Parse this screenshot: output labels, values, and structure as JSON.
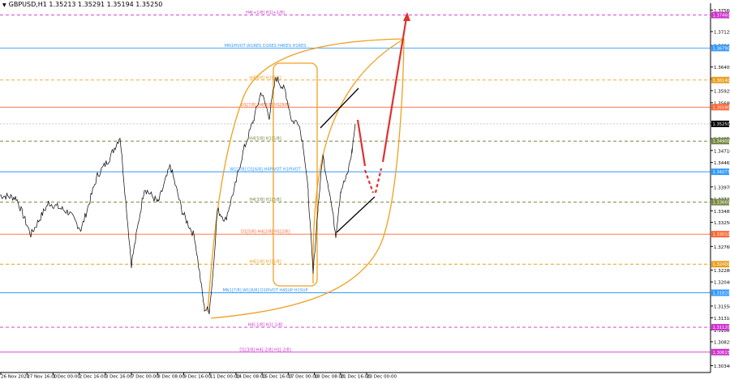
{
  "header": {
    "symbol_line": "GBPUSD,H1  1.35213 1.35291 1.35194 1.35250",
    "triangle_icon": "triangle-down-icon"
  },
  "chart_data": {
    "type": "line",
    "title": "GBPUSD,H1",
    "ohlc": {
      "open": 1.35213,
      "high": 1.35291,
      "low": 1.35194,
      "close": 1.3525
    },
    "y_ticks": [
      1.3756,
      1.37125,
      1.36845,
      1.36405,
      1.36165,
      1.35925,
      1.3568,
      1.3525,
      1.3495,
      1.3471,
      1.34465,
      1.3397,
      1.33725,
      1.33485,
      1.3325,
      1.3276,
      1.3228,
      1.3204,
      1.3155,
      1.3131,
      1.31065,
      1.30825,
      1.3034
    ],
    "x_ticks": [
      "26 Nov 2020",
      "27 Nov 16:00",
      "1 Dec 00:00",
      "2 Dec 16:00",
      "3 Dec 16:00",
      "7 Dec 00:00",
      "8 Dec 08:00",
      "9 Dec 16:00",
      "11 Dec 00:00",
      "14 Dec 08:00",
      "15 Dec 16:00",
      "17 Dec 00:00",
      "18 Dec 08:00",
      "21 Dec 16:00",
      "23 Dec 00:00"
    ],
    "price_line": {
      "value": 1.3525,
      "label": "1.35250",
      "color": "#000000"
    },
    "levels": [
      {
        "label": "H4[+1/8] H1[+1/8]",
        "value": 1.3746,
        "tag": "1.37460",
        "color": "#cc33cc",
        "dash": "dashed"
      },
      {
        "label": "MN1PIVOT W1RES D1RES H4RES H1RES",
        "value": 1.3679,
        "tag": "1.36790",
        "color": "#3399ff",
        "dash": "solid"
      },
      {
        "label": "H4[8/8] H1[8/8]",
        "value": 1.3614,
        "tag": "1.36140",
        "color": "#e8a020",
        "dash": "dashed"
      },
      {
        "label": "D1[7/8] H4[8/8] H1[8/8]",
        "value": 1.3559,
        "tag": "1.35590",
        "color": "#ff6633",
        "dash": "solid"
      },
      {
        "label": "H4[5/8] H1[5/8]",
        "value": 1.349,
        "tag": "1.34900",
        "color": "#778844",
        "dash": "dashed"
      },
      {
        "label": "W1[7/8] D1[6/8] H4PIVOT H1PIVOT",
        "value": 1.34277,
        "tag": "1.34277",
        "color": "#3399ff",
        "dash": "solid"
      },
      {
        "label": "H4[3/8] H1[3/8]",
        "value": 1.3366,
        "tag": "1.33660",
        "color": "#778844",
        "dash": "dashed"
      },
      {
        "label": "D1[5/8] H4[2/8] H1[2/8]",
        "value": 1.3301,
        "tag": "1.33010",
        "color": "#ff6633",
        "dash": "solid"
      },
      {
        "label": "H4[1/8] H1[1/8]",
        "value": 1.324,
        "tag": "1.32400",
        "color": "#e8a020",
        "dash": "dashed"
      },
      {
        "label": "MN1[7/8] W1[6/8] D1PIVOT H4SUP H1SUP",
        "value": 1.3182,
        "tag": "1.31820",
        "color": "#3399ff",
        "dash": "solid"
      },
      {
        "label": "H4[-1/8] H1[-1/8]",
        "value": 1.3112,
        "tag": "1.31120",
        "color": "#cc33cc",
        "dash": "dashed"
      },
      {
        "label": "D1[3/8] H4[-2/8] H1[-2/8]",
        "value": 1.30615,
        "tag": "1.30615",
        "color": "#cc33cc",
        "dash": "solid"
      }
    ],
    "accent_colors": {
      "projection": "#e03030",
      "ellipse": "#f0a020",
      "trend": "#000000"
    }
  }
}
